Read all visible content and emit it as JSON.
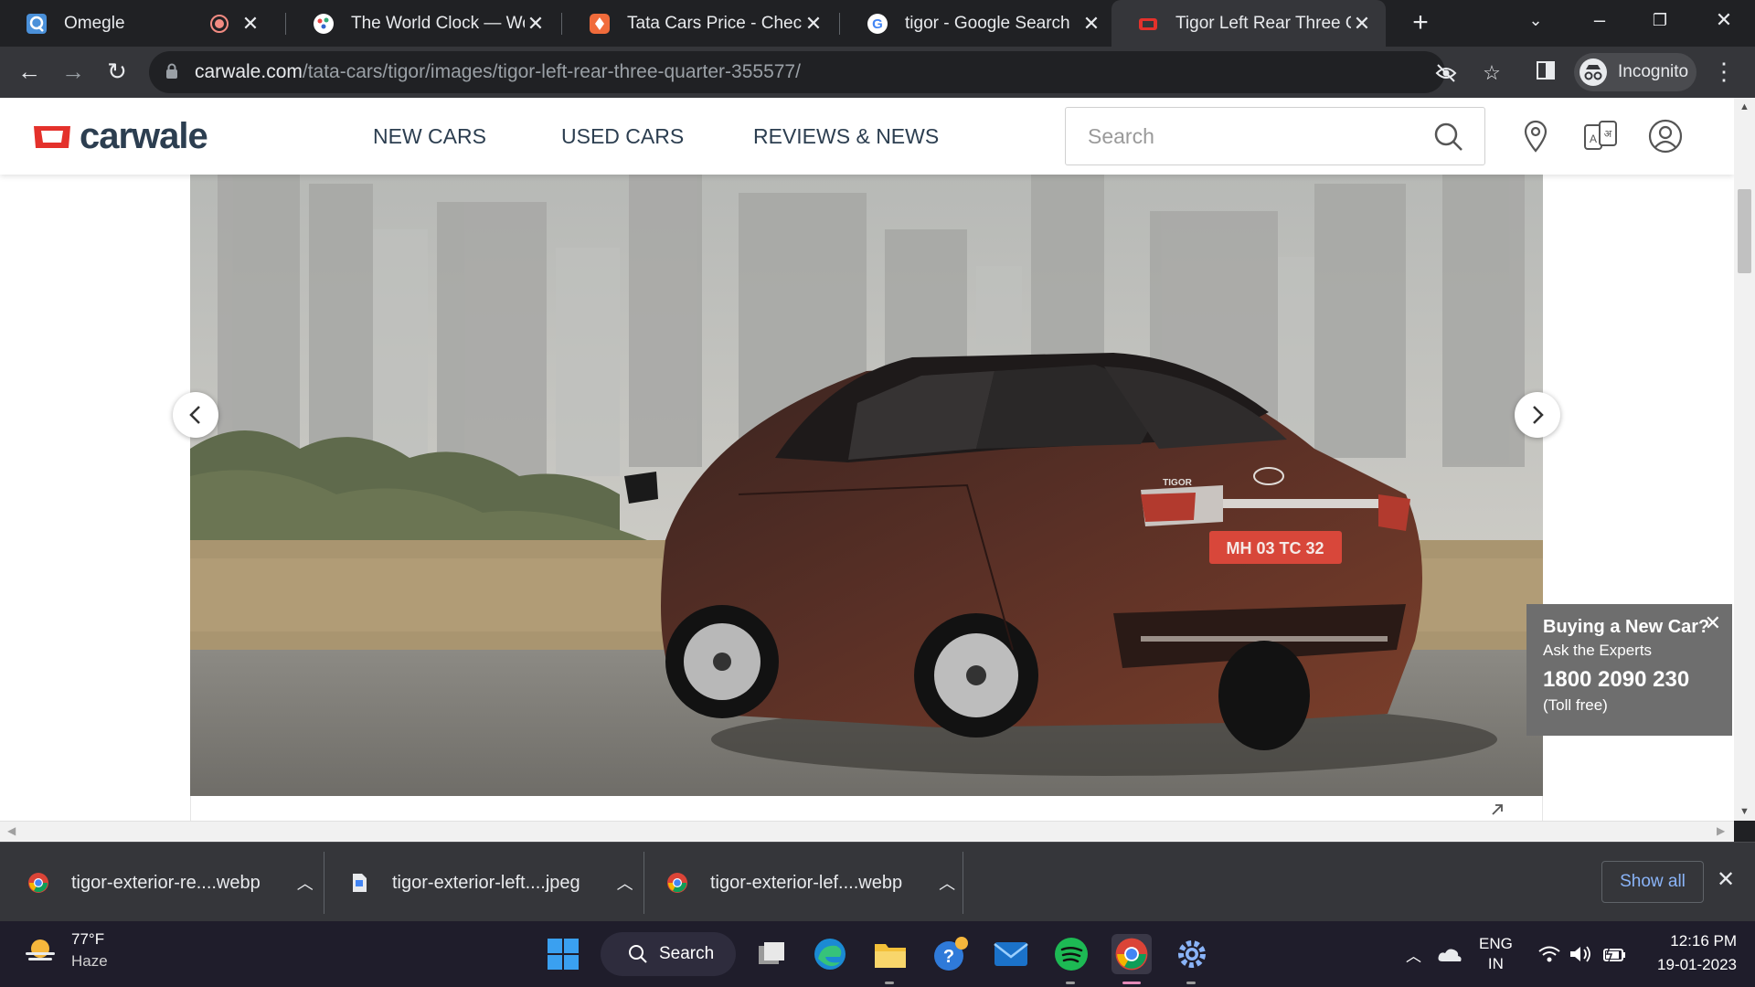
{
  "browser": {
    "tabs": [
      {
        "title": "Omegle",
        "favicon": "omegle-favicon"
      },
      {
        "title": "The World Clock — World",
        "favicon": "worldclock-favicon"
      },
      {
        "title": "Tata Cars Price - Check Ta",
        "favicon": "tata-favicon"
      },
      {
        "title": "tigor - Google Search",
        "favicon": "google-favicon"
      },
      {
        "title": "Tigor Left Rear Three Qua",
        "favicon": "carwale-favicon",
        "active": true
      }
    ],
    "url_host": "carwale.com",
    "url_path": "/tata-cars/tigor/images/tigor-left-rear-three-quarter-355577/",
    "profile_label": "Incognito"
  },
  "site": {
    "logo_text": "carwale",
    "nav": [
      "NEW CARS",
      "USED CARS",
      "REVIEWS & NEWS"
    ],
    "search_placeholder": "Search",
    "plate_text": "MH 03 TC 32",
    "badge_text": "TIGOR",
    "expert_popup": {
      "title": "Buying a New Car?",
      "subtitle": "Ask the Experts",
      "phone": "1800 2090 230",
      "note": "(Toll free)"
    }
  },
  "downloads": {
    "items": [
      {
        "name": "tigor-exterior-re....webp",
        "icon": "chrome-icon"
      },
      {
        "name": "tigor-exterior-left....jpeg",
        "icon": "file-icon"
      },
      {
        "name": "tigor-exterior-lef....webp",
        "icon": "chrome-icon"
      }
    ],
    "show_all": "Show all"
  },
  "taskbar": {
    "weather_temp": "77°F",
    "weather_cond": "Haze",
    "search_label": "Search",
    "lang_top": "ENG",
    "lang_bottom": "IN",
    "time": "12:16 PM",
    "date": "19-01-2023"
  },
  "colors": {
    "brand_red": "#e4312b",
    "brand_navy": "#2c3e50",
    "chrome_dark": "#202124",
    "chrome_mid": "#35363a"
  }
}
